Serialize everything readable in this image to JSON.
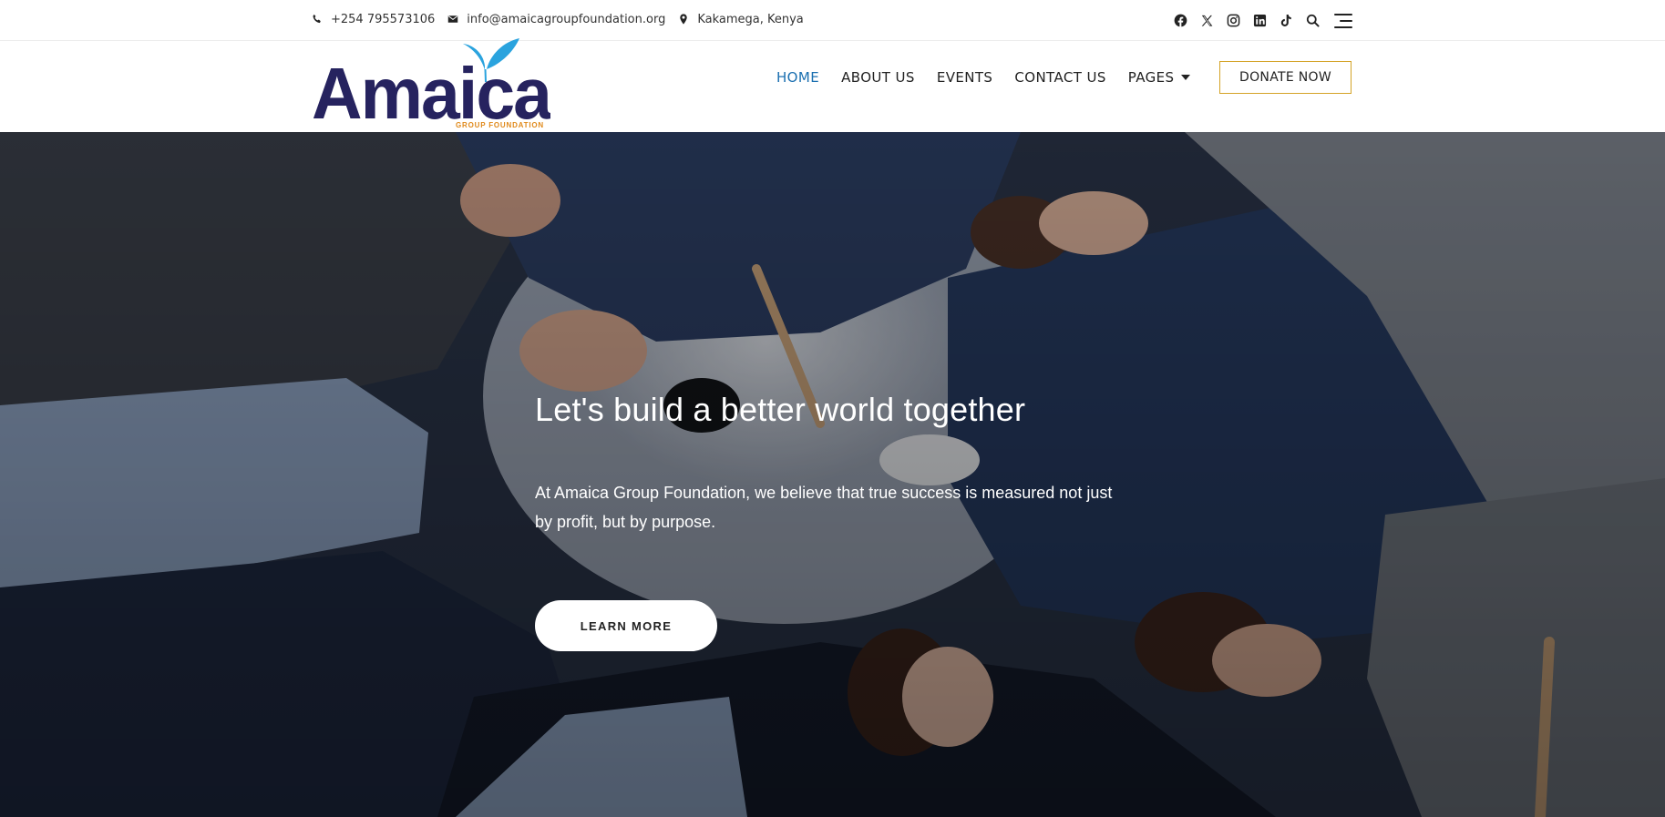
{
  "topbar": {
    "phone": "+254 795573106",
    "email": "info@amaicagroupfoundation.org",
    "location": "Kakamega, Kenya",
    "social_icons": [
      "facebook-icon",
      "x-icon",
      "instagram-icon",
      "linkedin-icon",
      "tiktok-icon",
      "search-icon",
      "menu-icon"
    ]
  },
  "logo": {
    "wordmark": "Amaica",
    "tagline": "GROUP FOUNDATION",
    "colors": {
      "wordmark": "#26235f",
      "leaves": "#2aa3de",
      "tagline": "#e08a1c"
    }
  },
  "nav": {
    "items": [
      {
        "label": "HOME",
        "active": true
      },
      {
        "label": "ABOUT US",
        "active": false
      },
      {
        "label": "EVENTS",
        "active": false
      },
      {
        "label": "CONTACT US",
        "active": false
      },
      {
        "label": "PAGES",
        "active": false,
        "has_dropdown": true
      }
    ],
    "donate_label": "DONATE NOW"
  },
  "hero": {
    "title": "Let's build a better world together",
    "text": "At Amaica Group Foundation, we believe that true success is measured not just by profit, but by purpose.",
    "button_label": "LEARN MORE"
  },
  "colors": {
    "nav_active": "#1a6fb0",
    "donate_border": "#d4a326"
  }
}
